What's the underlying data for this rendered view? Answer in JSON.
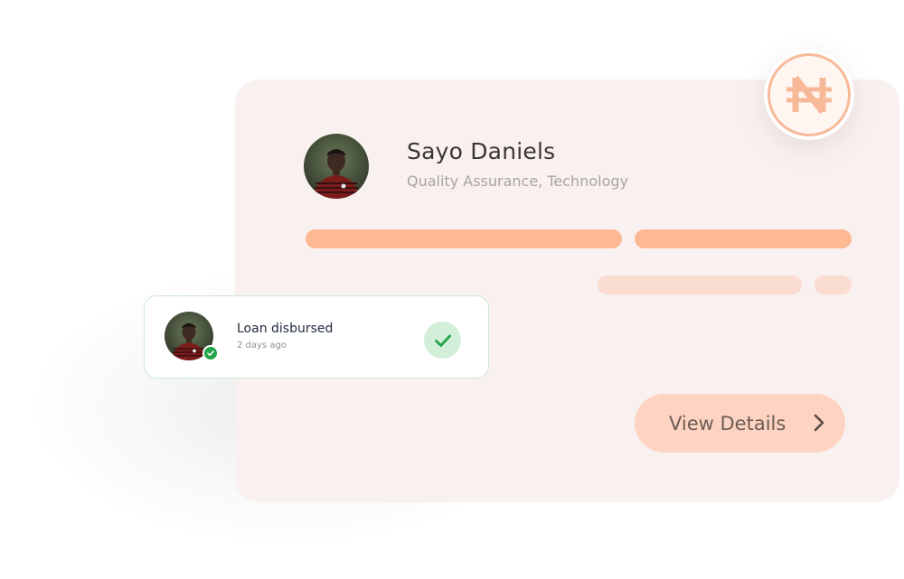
{
  "profile": {
    "name": "Sayo Daniels",
    "role": "Quality Assurance, Technology"
  },
  "actions": {
    "view_details_label": "View Details"
  },
  "notification": {
    "title": "Loan disbursed",
    "time": "2 days ago"
  },
  "icons": {
    "currency": "naira-icon",
    "details_arrow": "chevron-right-icon",
    "verified_badge": "check-badge-icon",
    "status": "check-icon"
  },
  "colors": {
    "card_background": "#f9f1f0",
    "accent": "#fdb894",
    "accent_light": "#fbdcd0",
    "button_background": "#fcd4c1",
    "success": "#22a447",
    "success_light": "#d4efd9"
  }
}
